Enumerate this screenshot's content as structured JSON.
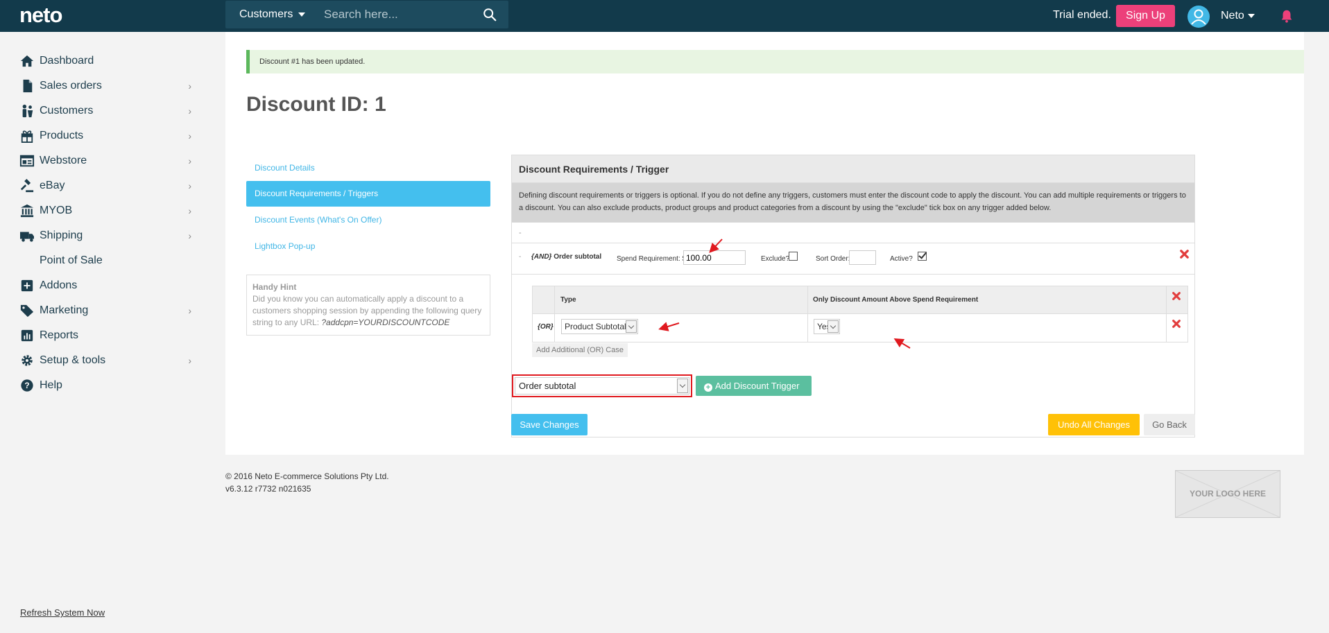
{
  "topbar": {
    "logo": "neto",
    "search_scope": "Customers",
    "search_placeholder": "Search here...",
    "trial_text": "Trial ended.",
    "signup_label": "Sign Up",
    "username": "Neto"
  },
  "sidebar": {
    "items": [
      {
        "label": "Dashboard",
        "icon": "home-icon",
        "chevron": false
      },
      {
        "label": "Sales orders",
        "icon": "document-icon",
        "chevron": true
      },
      {
        "label": "Customers",
        "icon": "people-icon",
        "chevron": true
      },
      {
        "label": "Products",
        "icon": "gift-icon",
        "chevron": true
      },
      {
        "label": "Webstore",
        "icon": "browser-icon",
        "chevron": true
      },
      {
        "label": "eBay",
        "icon": "gavel-icon",
        "chevron": true
      },
      {
        "label": "MYOB",
        "icon": "bank-icon",
        "chevron": true
      },
      {
        "label": "Shipping",
        "icon": "truck-icon",
        "chevron": true
      },
      {
        "label": "Point of Sale",
        "icon": "store-icon",
        "chevron": false
      },
      {
        "label": "Addons",
        "icon": "plus-square-icon",
        "chevron": false
      },
      {
        "label": "Marketing",
        "icon": "tag-icon",
        "chevron": true
      },
      {
        "label": "Reports",
        "icon": "bar-chart-icon",
        "chevron": false
      },
      {
        "label": "Setup & tools",
        "icon": "gear-icon",
        "chevron": true
      },
      {
        "label": "Help",
        "icon": "question-icon",
        "chevron": false
      }
    ],
    "refresh_link": "Refresh System Now"
  },
  "main": {
    "alert": "Discount #1 has been updated.",
    "title": "Discount ID: 1",
    "tabs": [
      {
        "label": "Discount Details",
        "active": false
      },
      {
        "label": "Discount Requirements / Triggers",
        "active": true
      },
      {
        "label": "Discount Events (What's On Offer)",
        "active": false
      },
      {
        "label": "Lightbox Pop-up",
        "active": false
      }
    ],
    "hint": {
      "title": "Handy Hint",
      "text": "Did you know you can automatically apply a discount to a customers shopping session by appending the following query string to any URL: ",
      "code": "?addcpn=YOURDISCOUNTCODE"
    }
  },
  "panel": {
    "title": "Discount Requirements / Trigger",
    "description": "Defining discount requirements or triggers is optional. If you do not define any triggers, customers must enter the discount code to apply the discount. You can add multiple requirements or triggers to a discount. You can also exclude products, product groups and product categories from a discount by using the \"exclude\" tick box on any trigger added below.",
    "dash": "-",
    "and_row": {
      "dash": "-",
      "and_prefix": "{AND}",
      "label": "Order subtotal",
      "spend_label": "Spend Requirement: $",
      "spend_value": "100.00",
      "exclude_label": "Exclude?",
      "sort_label": "Sort Order:",
      "sort_value": "",
      "active_label": "Active?"
    },
    "or_table": {
      "col_type": "Type",
      "col_only": "Only Discount Amount Above Spend Requirement",
      "or_label": "{OR}",
      "type_value": "Product Subtotal",
      "only_value": "Yes",
      "add_or": "Add Additional (OR) Case"
    },
    "trigger_select": "Order subtotal",
    "add_trigger": "Add Discount Trigger"
  },
  "buttons": {
    "save": "Save Changes",
    "undo": "Undo All Changes",
    "back": "Go Back"
  },
  "footer": {
    "copyright": "© 2016 Neto E-commerce Solutions Pty Ltd.",
    "version": "v6.3.12 r7732 n021635",
    "logo_placeholder": "YOUR LOGO HERE"
  },
  "colors": {
    "topbar": "#123a4b",
    "accent": "#44bfee",
    "signup": "#ec407a",
    "undo": "#ffc107",
    "add_trigger": "#5bbf9f",
    "highlight": "#e0191f"
  }
}
